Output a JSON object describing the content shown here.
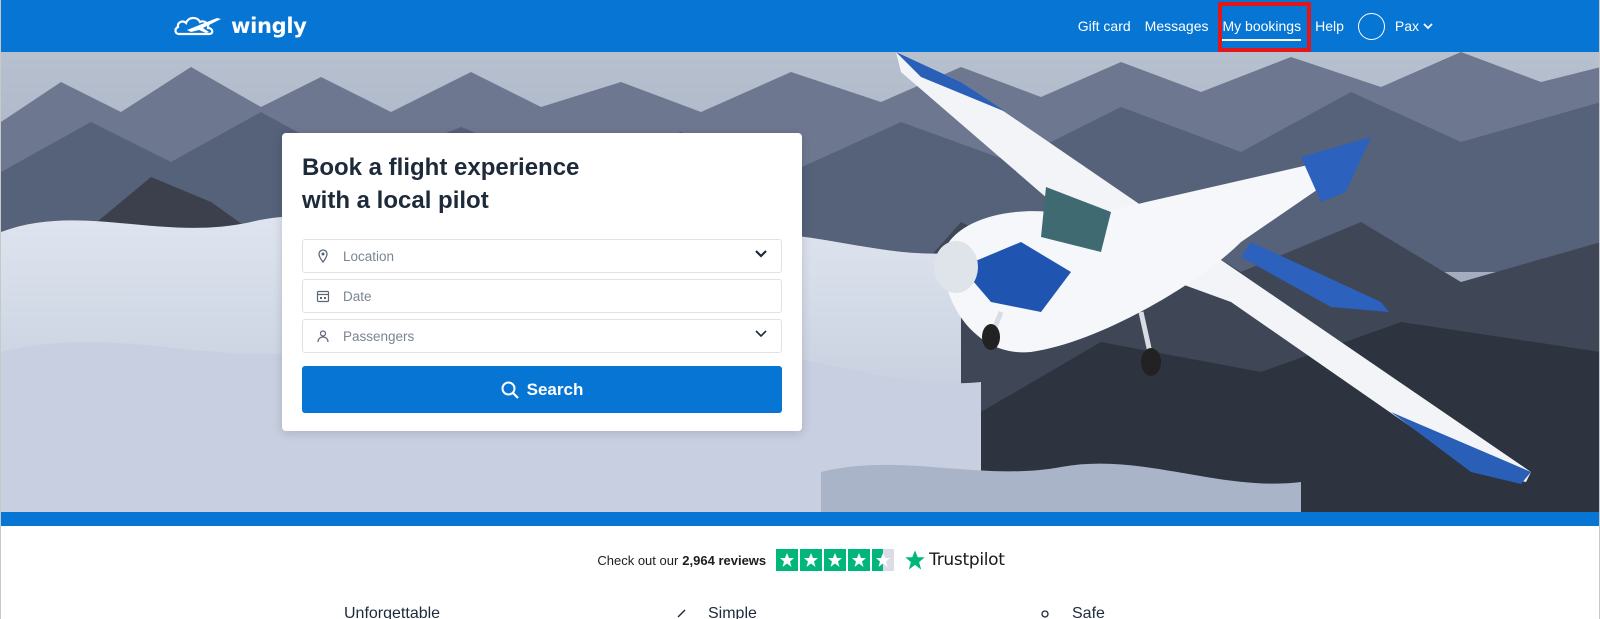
{
  "brand": {
    "name": "wingly"
  },
  "nav": {
    "links": [
      {
        "label": "Gift card"
      },
      {
        "label": "Messages"
      },
      {
        "label": "My bookings"
      },
      {
        "label": "Help"
      }
    ],
    "user": {
      "name": "Pax"
    }
  },
  "search": {
    "title_line1": "Book a flight experience",
    "title_line2": "with a local pilot",
    "location_placeholder": "Location",
    "date_placeholder": "Date",
    "passengers_placeholder": "Passengers",
    "button_label": "Search"
  },
  "trust": {
    "prefix": "Check out our",
    "count": "2,964 reviews",
    "brand": "Trustpilot",
    "stars": 4.5
  },
  "features": [
    {
      "label": "Unforgettable"
    },
    {
      "label": "Simple"
    },
    {
      "label": "Safe"
    }
  ],
  "colors": {
    "primary": "#0775d3",
    "trustpilot": "#00b67a",
    "highlight": "#e3161a"
  }
}
